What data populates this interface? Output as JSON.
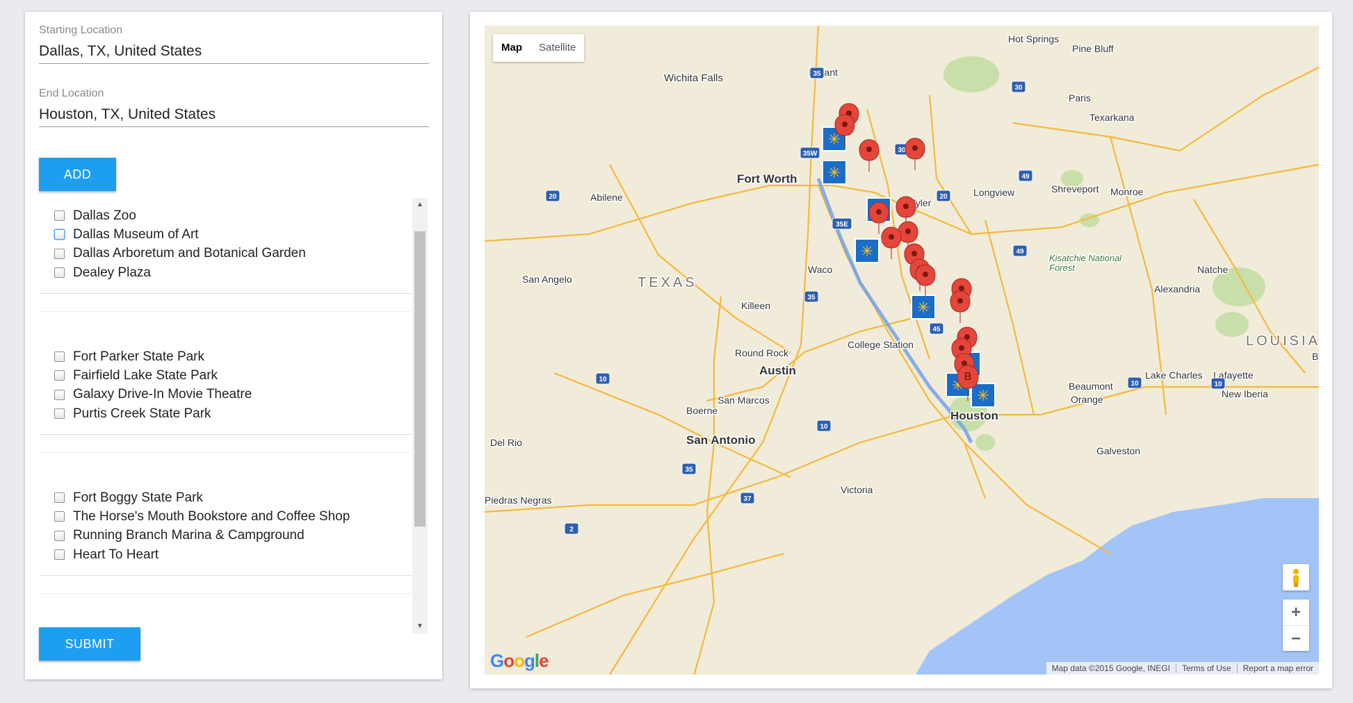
{
  "form": {
    "start_label": "Starting Location",
    "start_value": "Dallas, TX, United States",
    "end_label": "End Location",
    "end_value": "Houston, TX, United States",
    "add_label": "ADD",
    "submit_label": "SUBMIT"
  },
  "groups": [
    {
      "items": [
        "Dallas Zoo",
        "Dallas Museum of Art",
        "Dallas Arboretum and Botanical Garden",
        "Dealey Plaza"
      ]
    },
    {
      "items": [
        "Fort Parker State Park",
        "Fairfield Lake State Park",
        "Galaxy Drive-In Movie Theatre",
        "Purtis Creek State Park"
      ]
    },
    {
      "items": [
        "Fort Boggy State Park",
        "The Horse's Mouth Bookstore and Coffee Shop",
        "Running Branch Marina & Campground",
        "Heart To Heart"
      ]
    }
  ],
  "map": {
    "type_map": "Map",
    "type_satellite": "Satellite",
    "zoom_in": "+",
    "zoom_out": "−",
    "attribution": "Map data ©2015 Google, INEGI",
    "terms": "Terms of Use",
    "report": "Report a map error",
    "marker_b": "B",
    "colors": {
      "land": "#f1ebd9",
      "water": "#a3c4f6",
      "road": "#f4b93b",
      "park": "#c9dfa9",
      "marker": "#e5453a",
      "walmart": "#1a6dc9"
    },
    "places": [
      {
        "name": "Hot Springs"
      },
      {
        "name": "Pine Bluff"
      },
      {
        "name": "Durant"
      },
      {
        "name": "Wichita Falls"
      },
      {
        "name": "Paris"
      },
      {
        "name": "Texarkana"
      },
      {
        "name": "Fort Worth"
      },
      {
        "name": "Abilene"
      },
      {
        "name": "Tyler"
      },
      {
        "name": "Longview"
      },
      {
        "name": "Shreveport"
      },
      {
        "name": "Monroe"
      },
      {
        "name": "San Angelo"
      },
      {
        "name": "TEXAS"
      },
      {
        "name": "Waco"
      },
      {
        "name": "Kisatchie National Forest"
      },
      {
        "name": "Natche"
      },
      {
        "name": "Alexandria"
      },
      {
        "name": "Killeen"
      },
      {
        "name": "College Station"
      },
      {
        "name": "LOUISIA"
      },
      {
        "name": "Round Rock"
      },
      {
        "name": "Bato"
      },
      {
        "name": "Austin"
      },
      {
        "name": "Lake Charles"
      },
      {
        "name": "Lafayette"
      },
      {
        "name": "Beaumont"
      },
      {
        "name": "Orange"
      },
      {
        "name": "New Iberia"
      },
      {
        "name": "San Marcos"
      },
      {
        "name": "Boerne"
      },
      {
        "name": "Houston"
      },
      {
        "name": "San Antonio"
      },
      {
        "name": "Del Rio"
      },
      {
        "name": "Galveston"
      },
      {
        "name": "Victoria"
      },
      {
        "name": "Piedras Negras"
      }
    ],
    "highways": [
      "35",
      "30",
      "35W",
      "30",
      "49",
      "20",
      "20",
      "35E",
      "49",
      "35",
      "45",
      "10",
      "10",
      "10",
      "10",
      "35",
      "37",
      "2"
    ]
  }
}
